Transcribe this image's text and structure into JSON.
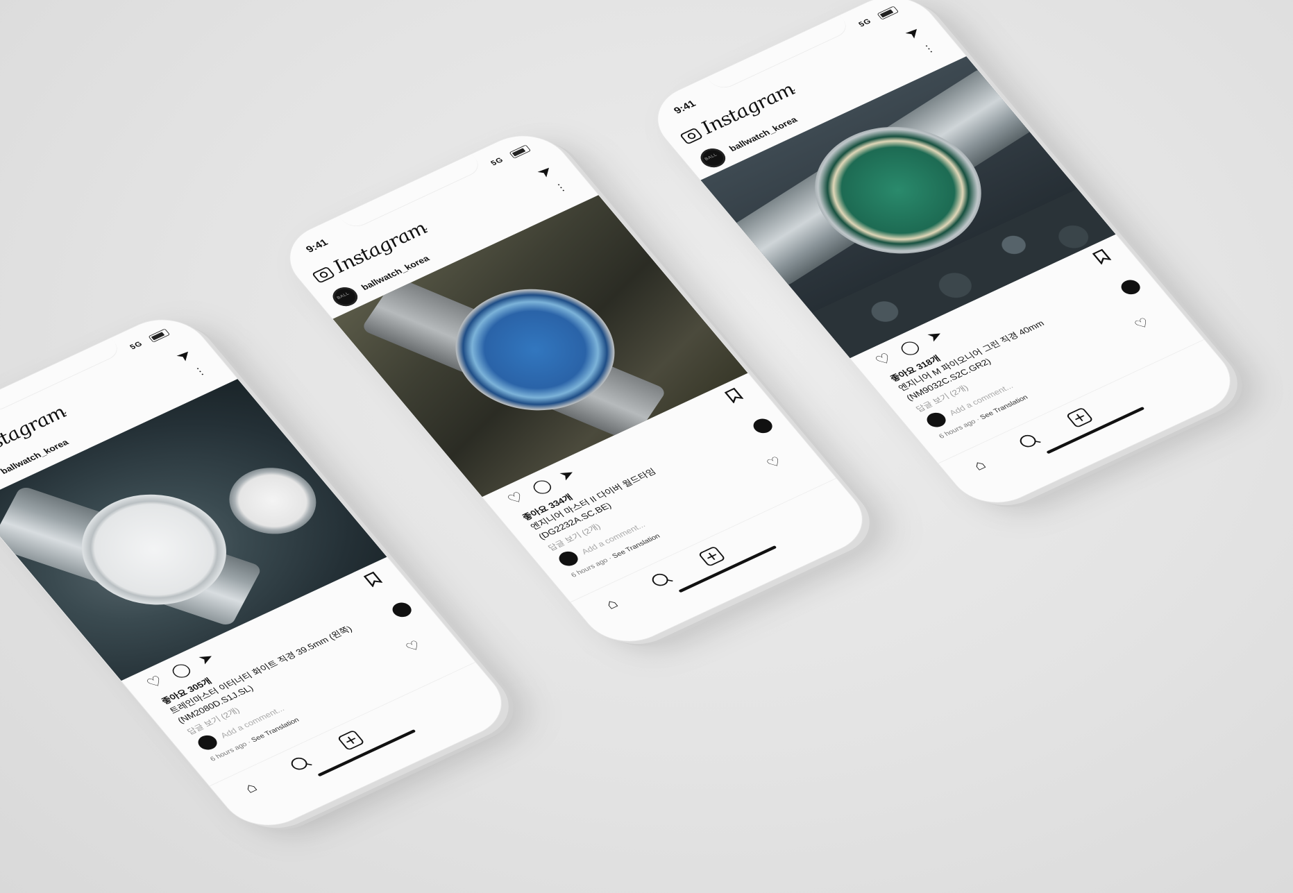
{
  "statusbar": {
    "time": "9:41",
    "signal": "5G"
  },
  "app": {
    "logo_text": "Instagram",
    "username": "ballwatch_korea",
    "chevron": "⌄"
  },
  "posts": [
    {
      "likes": "좋아요 305개",
      "caption": "트레인마스터 이터너티 화이트 직경 39.5mm (왼쪽)",
      "code": "(NM2080D.S1J.SL)",
      "comments_link": "답글 보기 (2개)",
      "comment_placeholder": "Add a comment...",
      "time_ago": "6 hours ago",
      "see_translation": "See Translation",
      "watch_dial_color": "#e9ebec",
      "accent": "#c9c9c9"
    },
    {
      "likes": "좋아요 334개",
      "caption": "엔지니어 마스터 II 다이버 월드타임",
      "code": "(DG2232A.SC.BE)",
      "comments_link": "답글 보기 (2개)",
      "comment_placeholder": "Add a comment...",
      "time_ago": "6 hours ago",
      "see_translation": "See Translation",
      "watch_dial_color": "#2a63a8",
      "accent": "#7cb3d9"
    },
    {
      "likes": "좋아요 318개",
      "caption": "엔지니어 M 파이오니어 그린 직경 40mm",
      "code": "(NM9032C.S2C.GR2)",
      "comments_link": "답글 보기 (2개)",
      "comment_placeholder": "Add a comment...",
      "time_ago": "6 hours ago",
      "see_translation": "See Translation",
      "watch_dial_color": "#1d6b53",
      "accent": "#e0d7b8"
    }
  ]
}
